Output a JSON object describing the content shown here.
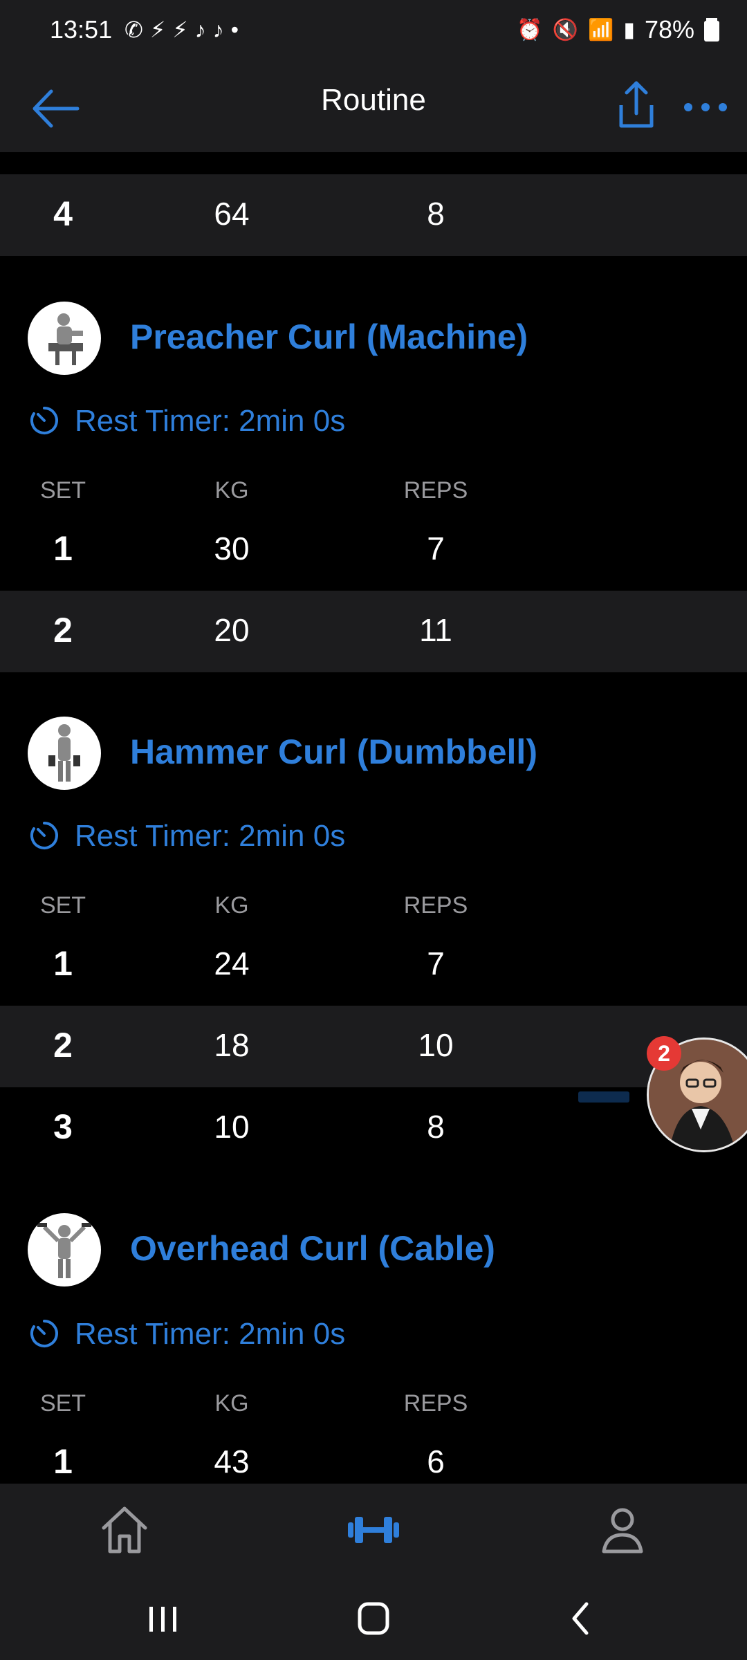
{
  "status": {
    "time": "13:51",
    "battery": "78%",
    "app_icons": [
      "whatsapp-icon",
      "messenger-icon",
      "messenger-icon",
      "tiktok-icon",
      "tiktok-icon",
      "dot"
    ]
  },
  "header": {
    "title": "Routine"
  },
  "partial_row": {
    "set": "4",
    "kg": "64",
    "reps": "8"
  },
  "exercises": [
    {
      "name": "Preacher Curl (Machine)",
      "rest": "Rest Timer: 2min 0s",
      "columns": {
        "set": "SET",
        "kg": "KG",
        "reps": "REPS"
      },
      "sets": [
        {
          "set": "1",
          "kg": "30",
          "reps": "7"
        },
        {
          "set": "2",
          "kg": "20",
          "reps": "11"
        }
      ]
    },
    {
      "name": "Hammer Curl (Dumbbell)",
      "rest": "Rest Timer: 2min 0s",
      "columns": {
        "set": "SET",
        "kg": "KG",
        "reps": "REPS"
      },
      "sets": [
        {
          "set": "1",
          "kg": "24",
          "reps": "7"
        },
        {
          "set": "2",
          "kg": "18",
          "reps": "10"
        },
        {
          "set": "3",
          "kg": "10",
          "reps": "8"
        }
      ]
    },
    {
      "name": "Overhead Curl (Cable)",
      "rest": "Rest Timer: 2min 0s",
      "columns": {
        "set": "SET",
        "kg": "KG",
        "reps": "REPS"
      },
      "sets": [
        {
          "set": "1",
          "kg": "43",
          "reps": "6"
        }
      ]
    }
  ],
  "chat_bubble": {
    "badge": "2"
  },
  "bottom_nav": [
    "home-icon",
    "dumbbell-icon",
    "profile-icon"
  ],
  "colors": {
    "accent": "#2f7fdb",
    "bg": "#000000",
    "surface": "#1c1c1e"
  }
}
